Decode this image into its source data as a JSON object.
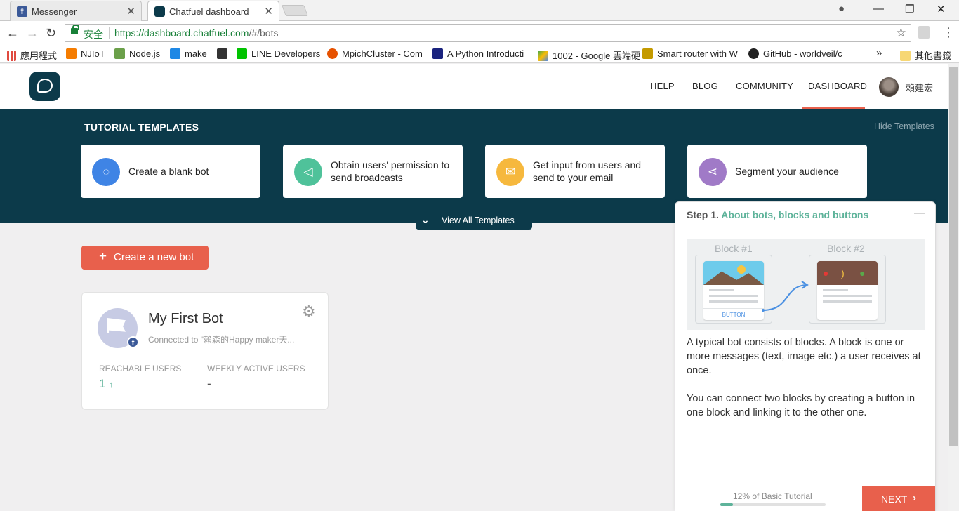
{
  "browser": {
    "tabs": [
      {
        "label": "Messenger",
        "favicon": "f"
      },
      {
        "label": "Chatfuel dashboard"
      }
    ],
    "secure_label": "安全",
    "url_base": "https://dashboard.chatfuel.com",
    "url_rest": "/#/bots",
    "bookmarks": [
      {
        "label": "應用程式",
        "color": "#e04a3f"
      },
      {
        "label": "NJIoT",
        "color": "#f57c00"
      },
      {
        "label": "Node.js",
        "color": "#6ba04a"
      },
      {
        "label": "make",
        "color": "#1e88e5"
      },
      {
        "label": "LINE Developers",
        "color": "#00c300"
      },
      {
        "label": "MpichCluster - Com",
        "color": "#e65100"
      },
      {
        "label": "A Python Introducti",
        "color": "#1a237e"
      },
      {
        "label": "1002 - Google 雲端硬",
        "color": "#fbbc04"
      },
      {
        "label": "Smart router with W",
        "color": "#c49a00"
      },
      {
        "label": "GitHub - worldveil/c",
        "color": "#222222"
      }
    ],
    "bookmarks_more": "»",
    "other_bookmarks": "其他書籤"
  },
  "header": {
    "nav": [
      "HELP",
      "BLOG",
      "COMMUNITY",
      "DASHBOARD"
    ],
    "active": "DASHBOARD",
    "user_name": "賴建宏"
  },
  "tutorial": {
    "title": "TUTORIAL TEMPLATES",
    "hide_label": "Hide Templates",
    "cards": [
      {
        "label": "Create a blank bot",
        "color": "#3f84e5",
        "icon": "chat-bubble-icon"
      },
      {
        "label": "Obtain users' permission to send broadcasts",
        "color": "#4fc29a",
        "icon": "megaphone-icon"
      },
      {
        "label": "Get input from users and send to your email",
        "color": "#f6b83d",
        "icon": "mail-icon"
      },
      {
        "label": "Segment your audience",
        "color": "#a07ac7",
        "icon": "segment-icon"
      }
    ],
    "view_all": "View All Templates"
  },
  "create_bot": {
    "label": "Create a new bot"
  },
  "bot": {
    "name": "My First Bot",
    "connected": "Connected to \"賴森的Happy maker天...",
    "reachable_label": "REACHABLE USERS",
    "reachable_value": "1",
    "weekly_label": "WEEKLY ACTIVE USERS",
    "weekly_value": "-"
  },
  "panel": {
    "step": "Step 1.",
    "step_title": "About bots, blocks and buttons",
    "block1": "Block #1",
    "block2": "Block #2",
    "button_text": "BUTTON",
    "desc1": "A typical bot consists of blocks. A block is one or more messages (text, image etc.) a user receives at once.",
    "desc2": "You can connect two blocks by creating a button in one block and linking it to the other one.",
    "progress_label": "12% of Basic Tutorial",
    "progress": 0.12,
    "next": "NEXT"
  }
}
